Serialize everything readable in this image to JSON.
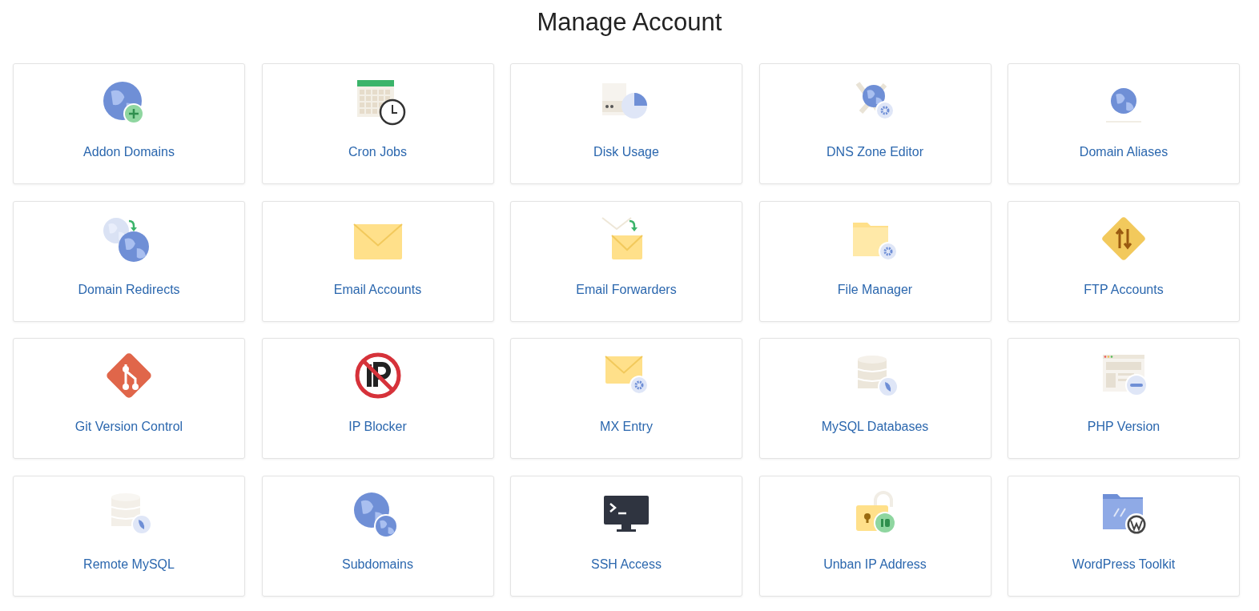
{
  "title": "Manage Account",
  "tiles": [
    {
      "label": "Addon Domains"
    },
    {
      "label": "Cron Jobs"
    },
    {
      "label": "Disk Usage"
    },
    {
      "label": "DNS Zone Editor"
    },
    {
      "label": "Domain Aliases"
    },
    {
      "label": "Domain Redirects"
    },
    {
      "label": "Email Accounts"
    },
    {
      "label": "Email Forwarders"
    },
    {
      "label": "File Manager"
    },
    {
      "label": "FTP Accounts"
    },
    {
      "label": "Git Version Control"
    },
    {
      "label": "IP Blocker"
    },
    {
      "label": "MX Entry"
    },
    {
      "label": "MySQL Databases"
    },
    {
      "label": "PHP Version"
    },
    {
      "label": "Remote MySQL"
    },
    {
      "label": "Subdomains"
    },
    {
      "label": "SSH Access"
    },
    {
      "label": "Unban IP Address"
    },
    {
      "label": "WordPress Toolkit"
    }
  ]
}
